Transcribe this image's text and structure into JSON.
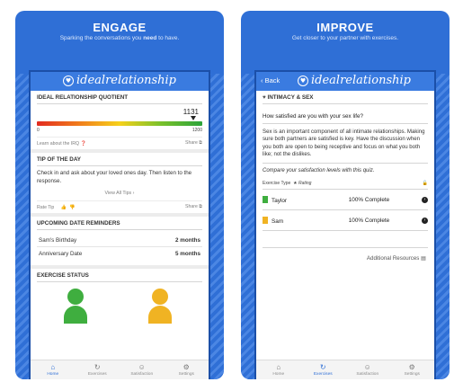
{
  "left_panel": {
    "title": "ENGAGE",
    "subtitle_pre": "Sparking the conversations you ",
    "subtitle_bold": "need",
    "subtitle_post": " to have.",
    "app_logo": "idealrelationship",
    "iq_card": {
      "title": "IDEAL RELATIONSHIP QUOTIENT",
      "score": "1131",
      "score_fraction": 0.943,
      "min": "0",
      "max": "1200",
      "learn_link": "Learn about the IRQ",
      "share": "Share"
    },
    "tip_card": {
      "title": "TIP OF THE DAY",
      "text": "Check in and ask about your loved ones day. Then listen to the response.",
      "all_tips": "View All Tips",
      "rate_label": "Rate Tip",
      "share": "Share"
    },
    "reminders_card": {
      "title": "UPCOMING DATE REMINDERS",
      "rows": [
        {
          "label": "Sam's Birthday",
          "value": "2 months"
        },
        {
          "label": "Anniversary Date",
          "value": "5 months"
        }
      ]
    },
    "exercise_card": {
      "title": "EXERCISE STATUS"
    },
    "tabs": [
      {
        "icon": "home-icon",
        "label": "Home",
        "active": true
      },
      {
        "icon": "refresh-icon",
        "label": "Exercises",
        "active": false
      },
      {
        "icon": "smiley-icon",
        "label": "Satisfaction",
        "active": false
      },
      {
        "icon": "gear-icon",
        "label": "Settings",
        "active": false
      }
    ]
  },
  "right_panel": {
    "title": "IMPROVE",
    "subtitle": "Get closer to your partner with exercises.",
    "back_label": "Back",
    "app_logo": "idealrelationship",
    "section_title": "INTIMACY & SEX",
    "question": "How satisfied are you with your sex life?",
    "paragraph": "Sex is an important component of all intimate relationships. Making sure both partners are satisfied is key. Have the discussion when you both are open to being receptive and focus on what you both like; not the dislikes.",
    "instruction": "Compare your satisfaction levels with this quiz.",
    "exercise_type_label": "Exercise Type",
    "exercise_type_value": "Rating",
    "participants": [
      {
        "name": "Taylor",
        "status": "100% Complete",
        "color": "#3fae3f"
      },
      {
        "name": "Sam",
        "status": "100% Complete",
        "color": "#f0b323"
      }
    ],
    "additional": "Additional Resources",
    "tabs": [
      {
        "icon": "home-icon",
        "label": "Home",
        "active": false
      },
      {
        "icon": "refresh-icon",
        "label": "Exercises",
        "active": true
      },
      {
        "icon": "smiley-icon",
        "label": "Satisfaction",
        "active": false
      },
      {
        "icon": "gear-icon",
        "label": "Settings",
        "active": false
      }
    ]
  },
  "colors": {
    "brand_blue": "#2f6fd6",
    "app_bar": "#3a7be0",
    "green_person": "#3fae3f",
    "yellow_person": "#f0b323"
  }
}
